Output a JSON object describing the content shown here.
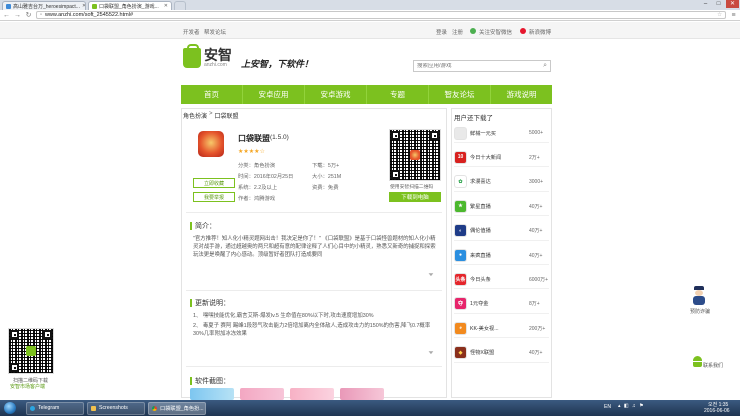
{
  "browser": {
    "tabs": [
      {
        "label": "高山雅吉台万_heroesimpact..."
      },
      {
        "label": "口袋联盟_角色扮演_游戏..."
      }
    ],
    "window_controls": {
      "minimize": "–",
      "maximize": "□",
      "close": "✕"
    },
    "url": "www.anzhi.com/soft_2545522.html#"
  },
  "topbar": {
    "left_links": [
      "开发者",
      "帮发论坛"
    ],
    "right_links": [
      "登录",
      "注册",
      "关注安智微信",
      "新浪微博"
    ]
  },
  "logo": {
    "text": "安智",
    "sub": "anzhi.com"
  },
  "slogan": "上安智，下软件！",
  "search": {
    "placeholder": "搜索应用/游戏"
  },
  "nav": [
    "首页",
    "安卓应用",
    "安卓游戏",
    "专题",
    "智友论坛",
    "游戏说明"
  ],
  "breadcrumb": {
    "category": "角色扮演",
    "sep": ">",
    "current": "口袋联盟"
  },
  "app": {
    "name": "口袋联盟",
    "version": "(1.5.0)",
    "stars": "★★★★☆",
    "category": "分类：角色扮演",
    "downloads": "下载：5万+",
    "date": "时间：2016年02月25日",
    "size": "大小：251M",
    "system": "系统：2.2及以上",
    "price": "资费：免费",
    "author": "作者：鸿腾游戏",
    "btn_favorite": "立即收藏",
    "btn_report": "我要举报",
    "qr_caption": "使用安智扫描二维码",
    "download_label": "下载到电脑"
  },
  "intro": {
    "title": "简介：",
    "text": "\"官方推荐！知人化小精灵题网出击！我决定是你了！\" 《口袋联盟》是基于口袋怪兽题材的知人化小精灵对战手游，通过超越奥的两只和超有意的配律诠释了人们心目中的小精灵，熟悉又新奇的捕捉和探索玩法更是唤醒了内心感动。顶级暂好者团队打造成要同"
  },
  "update": {
    "title": "更新说明：",
    "items": [
      "1、 嘿嘿技能优化,霸言艾斯-爆发lv.5 生命值在80%以下时,攻击速度增加30%",
      "2、 毒夏子 赛阿 踢峰1段怒气攻击能力2倍增加离内全体敌人,造成攻击力的150%的伤害,降飞0.7概率30%几率附加冰冻效果"
    ]
  },
  "screens": {
    "title": "软件截图："
  },
  "right": {
    "title": "用户还下载了",
    "items": [
      {
        "name": "鲜械一元买",
        "count": "5000+",
        "color": "#e9e9e9",
        "glyph": "",
        "text_color": "#f08c00"
      },
      {
        "name": "今日十大新闻",
        "count": "2万+",
        "color": "#d8211f",
        "glyph": "10",
        "text_color": "#ffffff"
      },
      {
        "name": "求漫喜达",
        "count": "3000+",
        "color": "#ffffff",
        "glyph": "✿",
        "text_color": "#2aa34a"
      },
      {
        "name": "繁星直播",
        "count": "40万+",
        "color": "#4cb82e",
        "glyph": "★",
        "text_color": "#ffffff"
      },
      {
        "name": "偶伦值播",
        "count": "40万+",
        "color": "#1f3c88",
        "glyph": "◐",
        "text_color": "#ffffff"
      },
      {
        "name": "来疯直播",
        "count": "40万+",
        "color": "#2b8fe0",
        "glyph": "●",
        "text_color": "#ffffff"
      },
      {
        "name": "今日头条",
        "count": "6000万+",
        "color": "#e4252b",
        "glyph": "头条",
        "text_color": "#ffffff"
      },
      {
        "name": "1元夺金",
        "count": "8万+",
        "color": "#e7256b",
        "glyph": "夺",
        "text_color": "#ffffff"
      },
      {
        "name": "KK-美女视...",
        "count": "200万+",
        "color": "#f28a1e",
        "glyph": "◕",
        "text_color": "#ffffff"
      },
      {
        "name": "怪物X联盟",
        "count": "40万+",
        "color": "#8a2f1c",
        "glyph": "◆",
        "text_color": "#ffd34d"
      }
    ]
  },
  "side_left": {
    "line1": "扫描二维码下载",
    "line2": "安智市场客户端"
  },
  "side_right": {
    "robot_label": "预防诈骗",
    "contact": "联系我们"
  },
  "taskbar": {
    "items": [
      "Telegram",
      "Screenshots",
      "口袋联盟_角色扮..."
    ],
    "lang": "EN",
    "time": "오전 1:35",
    "date": "2016-06-06"
  }
}
